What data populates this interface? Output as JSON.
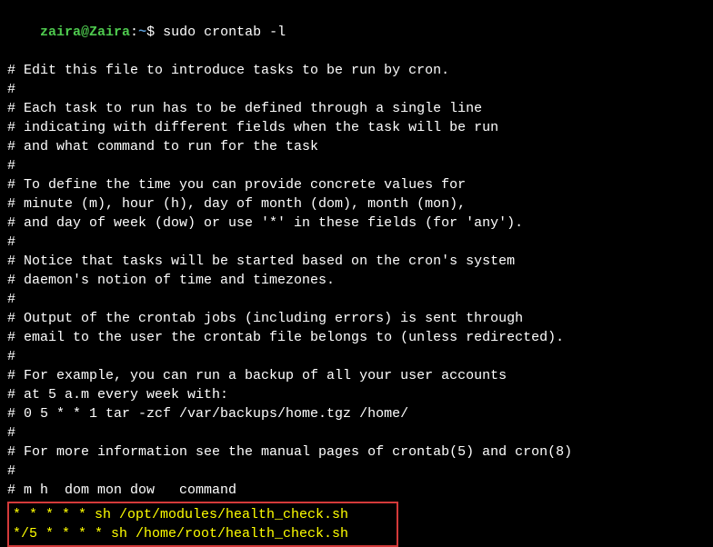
{
  "prompt": {
    "user_host": "zaira@Zaira",
    "colon": ":",
    "path": "~",
    "dollar": "$",
    "command": " sudo crontab -l"
  },
  "lines": [
    "# Edit this file to introduce tasks to be run by cron.",
    "#",
    "# Each task to run has to be defined through a single line",
    "# indicating with different fields when the task will be run",
    "# and what command to run for the task",
    "#",
    "# To define the time you can provide concrete values for",
    "# minute (m), hour (h), day of month (dom), month (mon),",
    "# and day of week (dow) or use '*' in these fields (for 'any').",
    "#",
    "# Notice that tasks will be started based on the cron's system",
    "# daemon's notion of time and timezones.",
    "#",
    "# Output of the crontab jobs (including errors) is sent through",
    "# email to the user the crontab file belongs to (unless redirected).",
    "#",
    "# For example, you can run a backup of all your user accounts",
    "# at 5 a.m every week with:",
    "# 0 5 * * 1 tar -zcf /var/backups/home.tgz /home/",
    "#",
    "# For more information see the manual pages of crontab(5) and cron(8)",
    "#",
    "# m h  dom mon dow   command",
    ""
  ],
  "highlighted": [
    "* * * * * sh /opt/modules/health_check.sh",
    "*/5 * * * * sh /home/root/health_check.sh"
  ]
}
